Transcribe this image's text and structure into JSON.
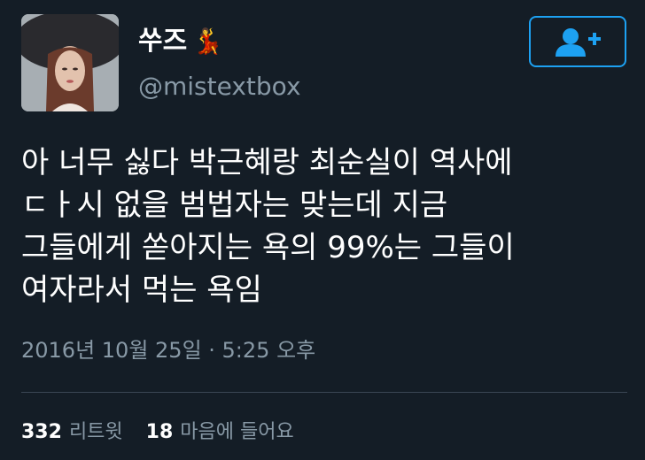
{
  "user": {
    "display_name": "쑤즈",
    "emoji": "💃",
    "handle": "@mistextbox",
    "avatar_icon": "profile-photo"
  },
  "follow_button": {
    "icon": "add-user-icon",
    "color": "#1da1f2"
  },
  "tweet": {
    "lines": [
      "아 너무 싫다 박근혜랑 최순실이 역사에",
      "ㄷㅏ시 없을 범법자는 맞는데 지금",
      "그들에게 쏟아지는 욕의 99%는 그들이",
      "여자라서 먹는 욕임"
    ]
  },
  "timestamp": "2016년 10월 25일 · 5:25 오후",
  "stats": {
    "retweets_count": "332",
    "retweets_label": "리트윗",
    "likes_count": "18",
    "likes_label": "마음에 들어요"
  },
  "colors": {
    "background": "#141d26",
    "secondary_text": "#8899a6",
    "accent": "#1da1f2"
  }
}
